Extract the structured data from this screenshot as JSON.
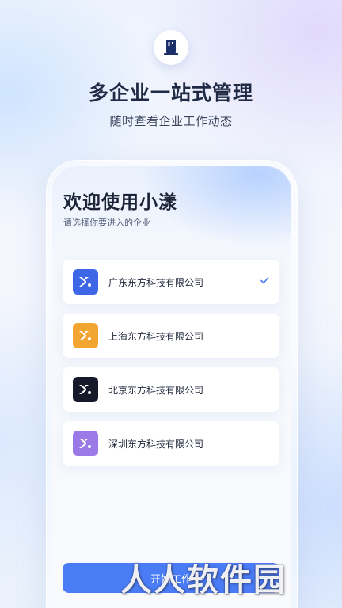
{
  "hero": {
    "logo_icon": "building-icon",
    "title": "多企业一站式管理",
    "subtitle": "随时查看企业工作动态"
  },
  "screen": {
    "welcome": "欢迎使用小漾",
    "hint": "请选择你要进入的企业",
    "companies": [
      {
        "name": "广东东方科技有限公司",
        "icon_color": "#3d67e6",
        "selected": true
      },
      {
        "name": "上海东方科技有限公司",
        "icon_color": "#f2a531",
        "selected": false
      },
      {
        "name": "北京东方科技有限公司",
        "icon_color": "#16192a",
        "selected": false
      },
      {
        "name": "深圳东方科技有限公司",
        "icon_color": "#9b7ae8",
        "selected": false
      }
    ],
    "start_button": "开始工作",
    "accent_color": "#4a7cf6"
  },
  "watermark": "人人软件园"
}
